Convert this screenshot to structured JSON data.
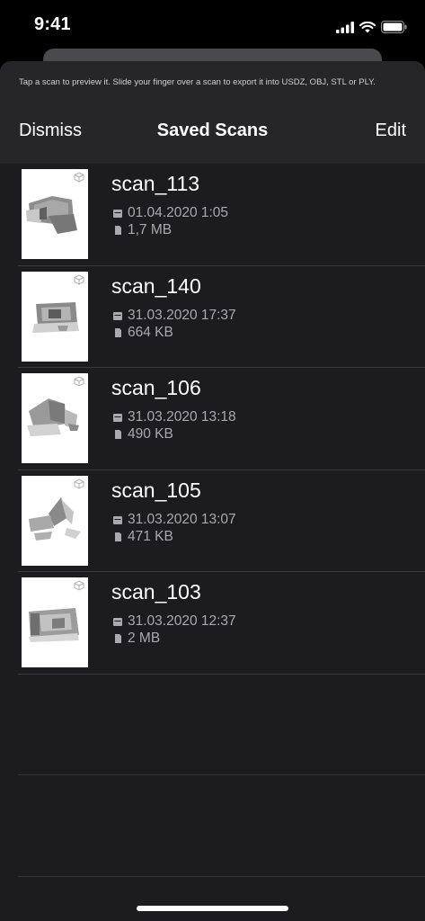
{
  "status": {
    "time": "9:41",
    "icons": [
      "cellular-signal-icon",
      "wifi-icon",
      "battery-icon"
    ]
  },
  "header": {
    "hint": "Tap a scan to preview it. Slide your finger over a scan to export it into USDZ, OBJ, STL or PLY.",
    "dismiss_label": "Dismiss",
    "title": "Saved Scans",
    "edit_label": "Edit"
  },
  "scans": [
    {
      "name": "scan_113",
      "date": "01.04.2020 1:05",
      "size": "1,7 MB"
    },
    {
      "name": "scan_140",
      "date": "31.03.2020 17:37",
      "size": "664 KB"
    },
    {
      "name": "scan_106",
      "date": "31.03.2020 13:18",
      "size": "490 KB"
    },
    {
      "name": "scan_105",
      "date": "31.03.2020 13:07",
      "size": "471 KB"
    },
    {
      "name": "scan_103",
      "date": "31.03.2020 12:37",
      "size": "2 MB"
    }
  ],
  "icons": {
    "date": "calendar-icon",
    "size": "file-icon",
    "thumb_badge": "cube-icon"
  },
  "colors": {
    "background": "#000000",
    "sheet": "#1c1c1e",
    "header": "#262628",
    "secondary_text": "#a9a9ae",
    "separator": "#3a3a3c"
  }
}
